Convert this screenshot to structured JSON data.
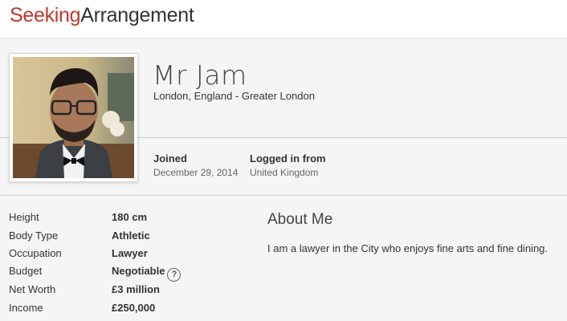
{
  "brand": {
    "logo_part1": "Seeking",
    "logo_part2": "Arrangement",
    "accent_color": "#c0392b"
  },
  "profile": {
    "name": "Mr Jam",
    "location": "London, England - Greater London",
    "joined_label": "Joined",
    "joined_value": "December 29, 2014",
    "logged_in_label": "Logged in from",
    "logged_in_value": "United Kingdom",
    "photo_icon": "profile-photo"
  },
  "stats": [
    {
      "label": "Height",
      "value": "180 cm"
    },
    {
      "label": "Body Type",
      "value": "Athletic"
    },
    {
      "label": "Occupation",
      "value": "Lawyer"
    },
    {
      "label": "Budget",
      "value": "Negotiable",
      "help_icon": "?"
    },
    {
      "label": "Net Worth",
      "value": "£3 million"
    },
    {
      "label": "Income",
      "value": "£250,000"
    }
  ],
  "about": {
    "title": "About Me",
    "text": "I am a lawyer in the City who enjoys fine arts and fine dining."
  }
}
